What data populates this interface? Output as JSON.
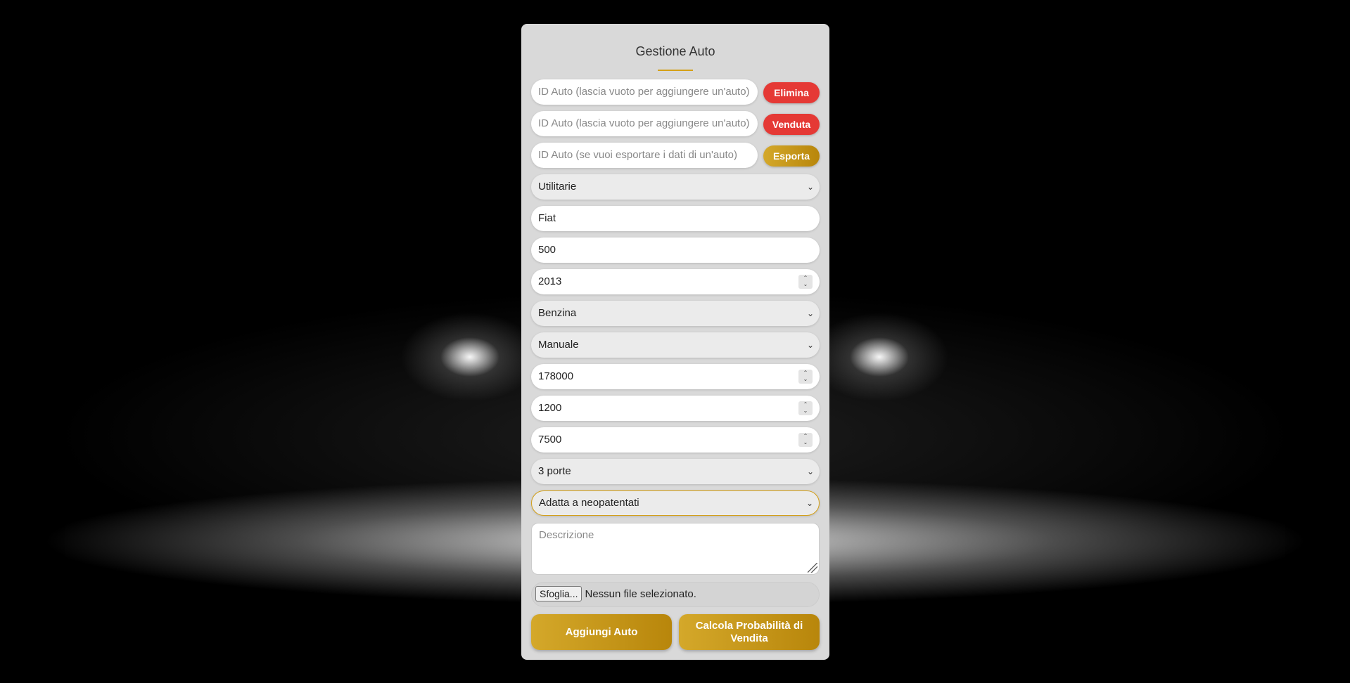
{
  "form": {
    "title": "Gestione Auto",
    "delete_row": {
      "placeholder": "ID Auto (lascia vuoto per aggiungere un'auto)",
      "button": "Elimina"
    },
    "sold_row": {
      "placeholder": "ID Auto (lascia vuoto per aggiungere un'auto)",
      "button": "Venduta"
    },
    "export_row": {
      "placeholder": "ID Auto (se vuoi esportare i dati di un'auto)",
      "button": "Esporta"
    },
    "category": "Utilitarie",
    "brand": "Fiat",
    "model": "500",
    "year": "2013",
    "fuel": "Benzina",
    "transmission": "Manuale",
    "mileage": "178000",
    "engine": "1200",
    "price": "7500",
    "doors": "3 porte",
    "neopatentati": "Adatta a neopatentati",
    "description_placeholder": "Descrizione",
    "file": {
      "button": "Sfoglia...",
      "status": "Nessun file selezionato."
    },
    "add_button": "Aggiungi Auto",
    "calc_button": "Calcola Probabilità di Vendita"
  },
  "colors": {
    "accent": "#d4a017",
    "danger": "#e53935",
    "panel": "#d9d9d9"
  }
}
